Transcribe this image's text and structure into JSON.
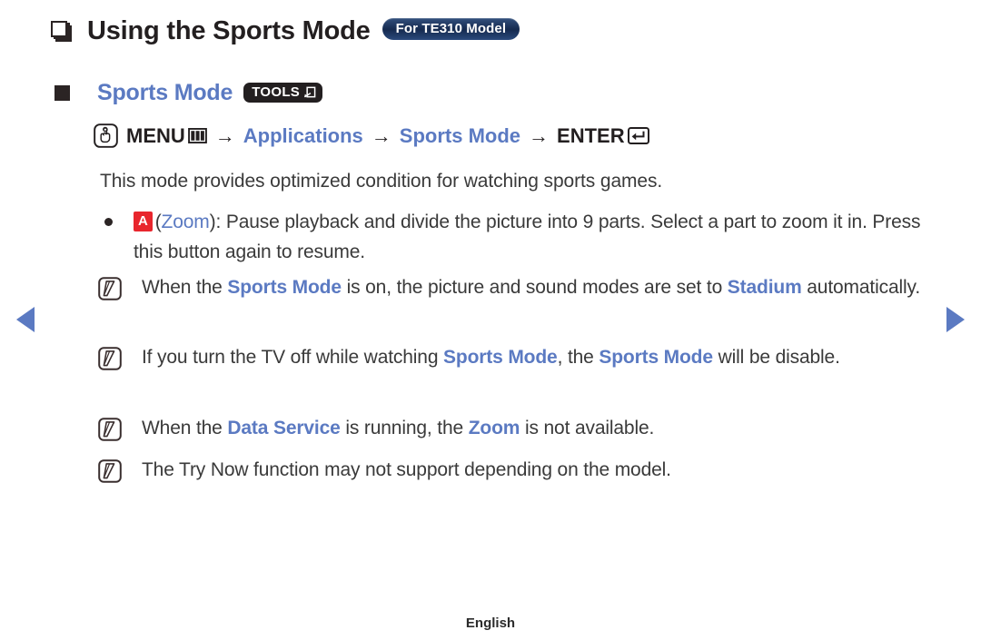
{
  "nav": {
    "prev_label": "Previous page",
    "next_label": "Next page",
    "prev_icon": "triangle-left-icon",
    "next_icon": "triangle-right-icon"
  },
  "title": {
    "text": "Using the Sports Mode",
    "badge": "For TE310 Model",
    "bullet_icon": "stacked-square-bullet-icon"
  },
  "subheading": {
    "text": "Sports Mode",
    "badge": "TOOLS",
    "badge_icon": "tools-arrow-box-icon",
    "bullet_icon": "solid-square-bullet-icon"
  },
  "menu_path": {
    "hand_icon": "hand-press-icon",
    "menu_label": "MENU",
    "menu_icon": "menu-grid-icon",
    "arrow": "→",
    "step_applications": "Applications",
    "step_sports_mode": "Sports Mode",
    "enter_label": "ENTER",
    "enter_icon": "enter-key-icon"
  },
  "intro": {
    "text": "This mode provides optimized condition for watching sports games."
  },
  "bullet": {
    "dot_icon": "dot-bullet-icon",
    "key_a": "A",
    "open_paren": "(",
    "zoom_word": "Zoom",
    "close_paren": "): ",
    "text_1": "Pause playback and divide the picture into 9 parts. Select a part to zoom it in. Press this button again to resume."
  },
  "notes": [
    {
      "icon": "note-pencil-icon",
      "parts": [
        {
          "t": "When the ",
          "style": "plain"
        },
        {
          "t": "Sports Mode",
          "style": "blue"
        },
        {
          "t": " is on, the picture and sound modes are set to ",
          "style": "plain"
        },
        {
          "t": "Stadium",
          "style": "blue"
        },
        {
          "t": " automatically.",
          "style": "plain"
        }
      ]
    },
    {
      "icon": "note-pencil-icon",
      "parts": [
        {
          "t": "If you turn the TV off while watching ",
          "style": "plain"
        },
        {
          "t": "Sports Mode",
          "style": "blue"
        },
        {
          "t": ", the ",
          "style": "plain"
        },
        {
          "t": "Sports Mode",
          "style": "blue"
        },
        {
          "t": " will be disable.",
          "style": "plain"
        }
      ]
    },
    {
      "icon": "note-pencil-icon",
      "parts": [
        {
          "t": "When the ",
          "style": "plain"
        },
        {
          "t": "Data Service",
          "style": "blue"
        },
        {
          "t": " is running, the ",
          "style": "plain"
        },
        {
          "t": "Zoom",
          "style": "blue"
        },
        {
          "t": " is not available.",
          "style": "plain"
        }
      ]
    },
    {
      "icon": "note-pencil-icon",
      "parts": [
        {
          "t": "The Try Now function may not support depending on the model.",
          "style": "plain"
        }
      ]
    }
  ],
  "footer": {
    "language": "English"
  },
  "colors": {
    "accent_blue": "#5b7ac2",
    "key_red": "#e8262d",
    "badge_navy": "#152a4f",
    "ink": "#231f20"
  }
}
